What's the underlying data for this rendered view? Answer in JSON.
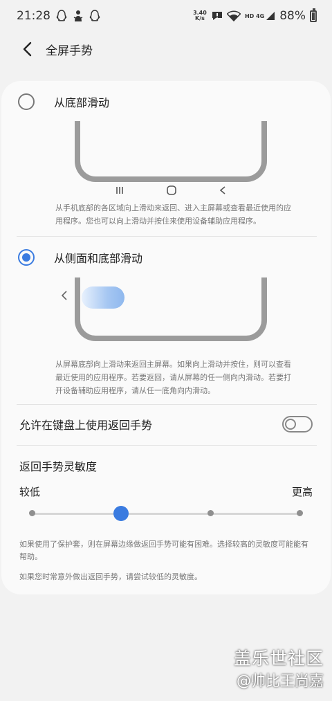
{
  "status_bar": {
    "time": "21:28",
    "speed_value": "3.40",
    "speed_unit": "K/s",
    "network": "HD 4G",
    "battery": "88%"
  },
  "header": {
    "title": "全屏手势",
    "back_icon": "chevron-left-icon"
  },
  "options": [
    {
      "label": "从底部滑动",
      "selected": false,
      "description": "从手机底部的各区域向上滑动来返回、进入主屏幕或查看最近使用的应用程序。您也可以向上滑动并按住来使用设备辅助应用程序。"
    },
    {
      "label": "从侧面和底部滑动",
      "selected": true,
      "description": "从屏幕底部向上滑动来返回主屏幕。如果向上滑动并按住，则可以查看最近使用的应用程序。若要返回，请从屏幕的任一侧向内滑动。若要打开设备辅助应用程序，请从任一底角向内滑动。"
    }
  ],
  "nav_buttons": [
    "III",
    "○",
    "<"
  ],
  "keyboard_back_gesture": {
    "label": "允许在键盘上使用返回手势",
    "enabled": false
  },
  "sensitivity": {
    "title": "返回手势灵敏度",
    "low_label": "较低",
    "high_label": "更高",
    "levels": 4,
    "value_index": 1,
    "note_1": "如果使用了保护套，则在屏幕边缘做返回手势可能有困难。选择较高的灵敏度可能能有帮助。",
    "note_2": "如果您时常意外做出返回手势，请尝试较低的灵敏度。"
  },
  "watermark": {
    "line1": "盖乐世社区",
    "line2": "@帅比王尚嘉"
  },
  "colors": {
    "accent": "#3a7be0",
    "background": "#f2f2f2",
    "card": "#fafafa"
  }
}
